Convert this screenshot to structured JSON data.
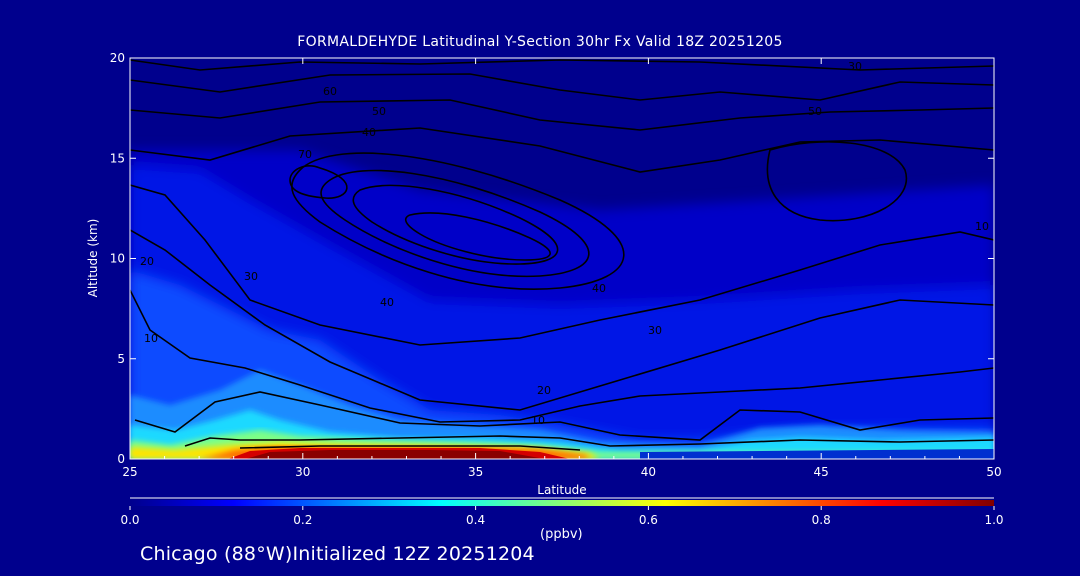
{
  "title": "FORMALDEHYDE Latitudinal Y-Section 30hr  Fx Valid 18Z 20251205",
  "footer": "Chicago (88°W)Initialized 12Z 20251204",
  "colorbar": {
    "unit_label": "(ppbv)",
    "ticks": [
      "0.0",
      "0.2",
      "0.4",
      "0.6",
      "0.8",
      "1.0"
    ],
    "range": [
      0,
      1
    ]
  },
  "colors": {
    "background": "#00008d",
    "text": "#ffffff",
    "contour": "#000000"
  },
  "chart_data": {
    "type": "heatmap",
    "title": "FORMALDEHYDE Latitudinal Y-Section 30hr  Fx Valid 18Z 20251205",
    "xlabel": "Latitude",
    "ylabel": "Altitude (km)",
    "xlim": [
      25,
      50
    ],
    "ylim": [
      0,
      20
    ],
    "x_ticks": [
      "25",
      "30",
      "35",
      "40",
      "45",
      "50"
    ],
    "y_ticks": [
      "0",
      "5",
      "10",
      "15",
      "20"
    ],
    "colormap": "jet",
    "value_range": [
      0,
      1
    ],
    "unit": "ppbv",
    "surface_maximum": {
      "lat_range": [
        28,
        38
      ],
      "altitude_km": [
        0,
        0.6
      ],
      "value": 1.0
    },
    "contour_labels": [
      "10",
      "20",
      "30",
      "40",
      "50",
      "60",
      "70"
    ]
  }
}
